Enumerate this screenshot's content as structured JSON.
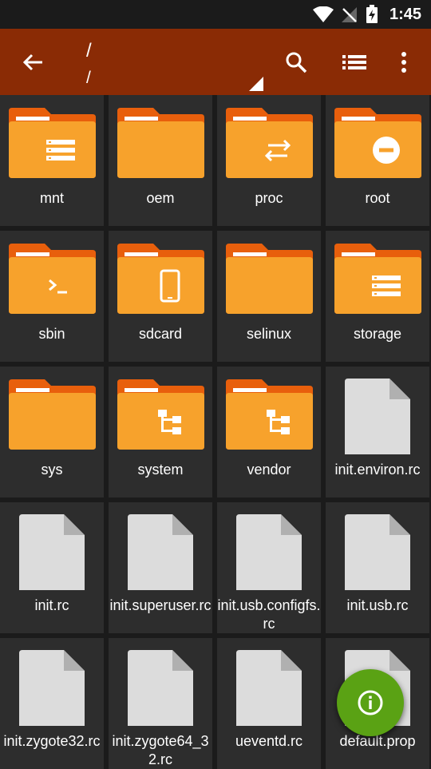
{
  "status": {
    "time": "1:45"
  },
  "header": {
    "path_primary": "/",
    "path_secondary": "/"
  },
  "icons": {
    "back": "arrow-left-icon",
    "search": "search-icon",
    "view": "list-view-icon",
    "menu": "more-vert-icon",
    "fab": "info-icon"
  },
  "colors": {
    "appbar": "#8a2b05",
    "folder": "#f7a22c",
    "fab": "#5aa214",
    "tile": "#2d2d2d"
  },
  "items": [
    {
      "name": "mnt",
      "type": "folder",
      "badge": "storage"
    },
    {
      "name": "oem",
      "type": "folder",
      "badge": "none"
    },
    {
      "name": "proc",
      "type": "folder",
      "badge": "swap"
    },
    {
      "name": "root",
      "type": "folder",
      "badge": "minus"
    },
    {
      "name": "sbin",
      "type": "folder",
      "badge": "terminal"
    },
    {
      "name": "sdcard",
      "type": "folder",
      "badge": "phone"
    },
    {
      "name": "selinux",
      "type": "folder",
      "badge": "none"
    },
    {
      "name": "storage",
      "type": "folder",
      "badge": "storage"
    },
    {
      "name": "sys",
      "type": "folder",
      "badge": "none"
    },
    {
      "name": "system",
      "type": "folder",
      "badge": "tree"
    },
    {
      "name": "vendor",
      "type": "folder",
      "badge": "tree"
    },
    {
      "name": "init.environ.rc",
      "type": "file"
    },
    {
      "name": "init.rc",
      "type": "file"
    },
    {
      "name": "init.superuser.rc",
      "type": "file"
    },
    {
      "name": "init.usb.configfs.rc",
      "type": "file"
    },
    {
      "name": "init.usb.rc",
      "type": "file"
    },
    {
      "name": "init.zygote32.rc",
      "type": "file"
    },
    {
      "name": "init.zygote64_32.rc",
      "type": "file"
    },
    {
      "name": "ueventd.rc",
      "type": "file"
    },
    {
      "name": "default.prop",
      "type": "file"
    }
  ]
}
